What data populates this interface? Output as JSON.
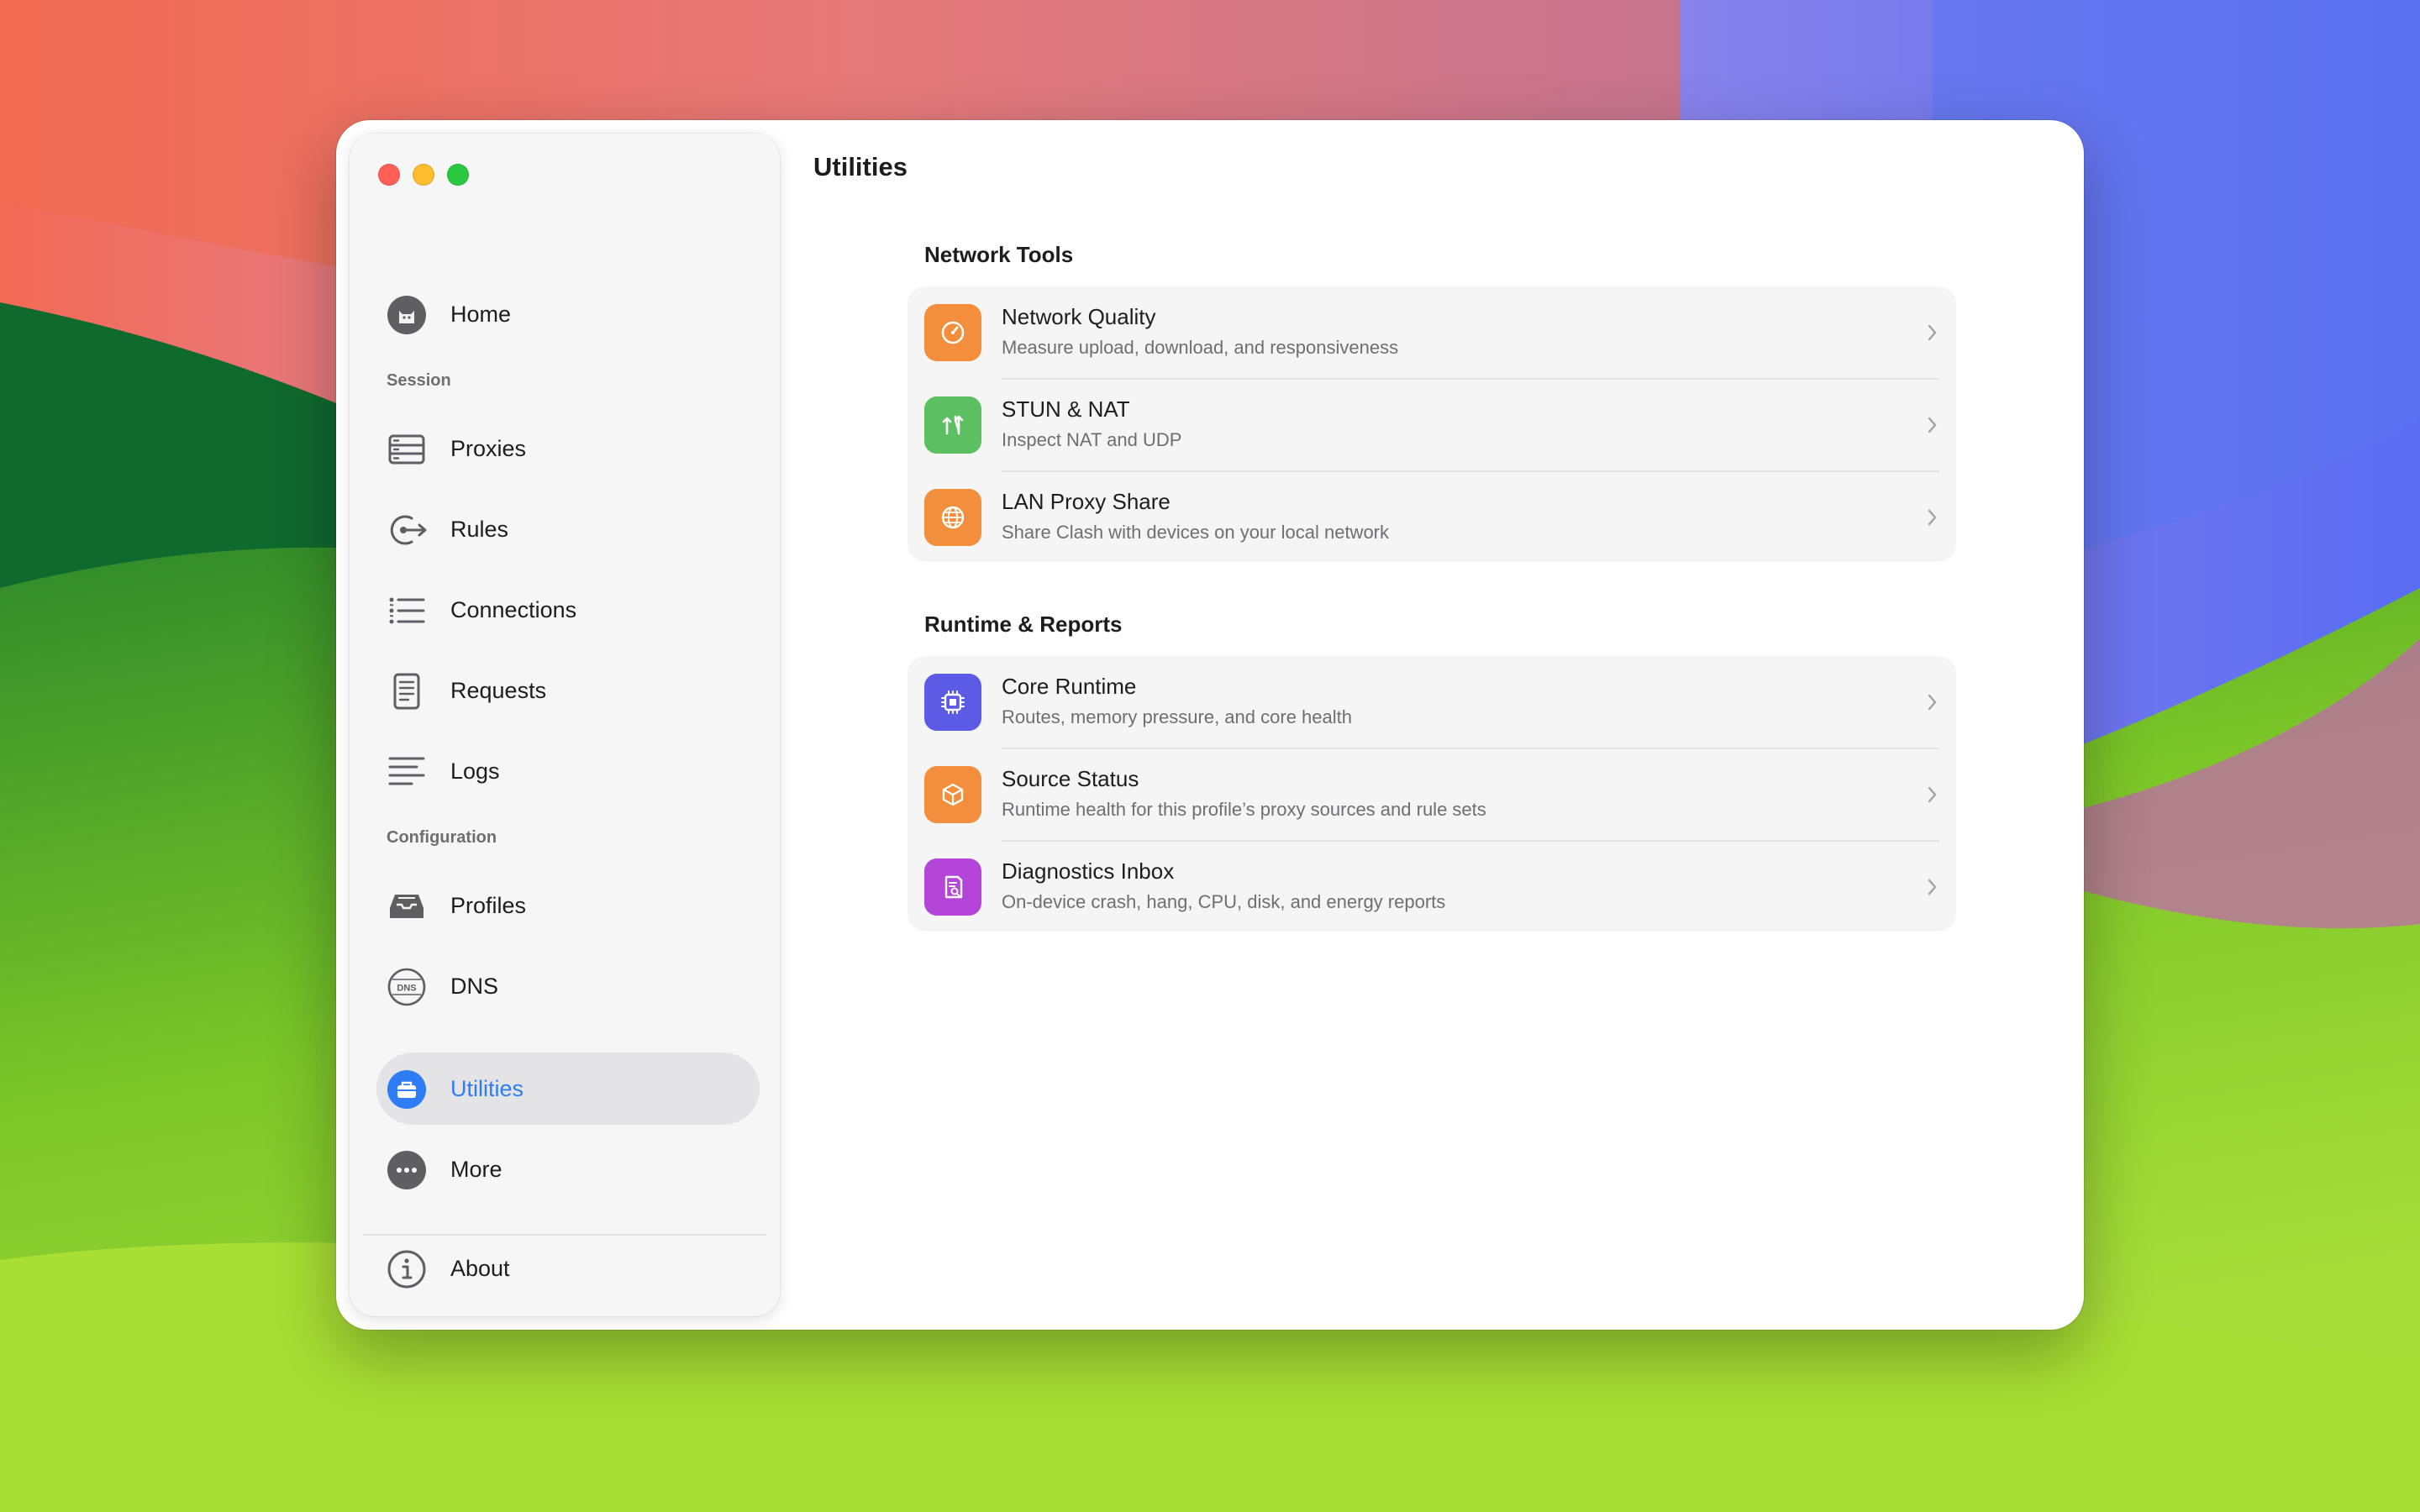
{
  "window": {
    "title": "Utilities"
  },
  "sidebar": {
    "home": {
      "label": "Home",
      "icon": "cat-avatar-icon"
    },
    "sections": {
      "session": "Session",
      "configuration": "Configuration"
    },
    "session_items": [
      {
        "label": "Proxies",
        "icon": "server-rack-icon"
      },
      {
        "label": "Rules",
        "icon": "rules-arrow-icon"
      },
      {
        "label": "Connections",
        "icon": "list-icon"
      },
      {
        "label": "Requests",
        "icon": "document-list-icon"
      },
      {
        "label": "Logs",
        "icon": "text-lines-icon"
      }
    ],
    "configuration_items": [
      {
        "label": "Profiles",
        "icon": "tray-icon"
      },
      {
        "label": "DNS",
        "icon": "dns-globe-icon"
      }
    ],
    "utilities": {
      "label": "Utilities",
      "icon": "toolbox-icon",
      "selected": true
    },
    "more": {
      "label": "More",
      "icon": "ellipsis-circle-icon"
    },
    "about": {
      "label": "About",
      "icon": "info-circle-icon"
    }
  },
  "groups": [
    {
      "title": "Network Tools",
      "items": [
        {
          "title": "Network Quality",
          "subtitle": "Measure upload, download, and responsiveness",
          "icon": "gauge-icon",
          "color": "#f38e3c"
        },
        {
          "title": "STUN & NAT",
          "subtitle": "Inspect NAT and UDP",
          "icon": "arrows-updown-icon",
          "color": "#5cc062"
        },
        {
          "title": "LAN Proxy Share",
          "subtitle": "Share Clash with devices on your local network",
          "icon": "globe-icon",
          "color": "#f38e3c"
        }
      ]
    },
    {
      "title": "Runtime & Reports",
      "items": [
        {
          "title": "Core Runtime",
          "subtitle": "Routes, memory pressure, and core health",
          "icon": "cpu-icon",
          "color": "#5b5be6"
        },
        {
          "title": "Source Status",
          "subtitle": "Runtime health for this profile’s proxy sources and rule sets",
          "icon": "cube-icon",
          "color": "#f38e3c"
        },
        {
          "title": "Diagnostics Inbox",
          "subtitle": "On-device crash, hang, CPU, disk, and energy reports",
          "icon": "report-search-icon",
          "color": "#b544d8"
        }
      ]
    }
  ],
  "colors": {
    "accent": "#2f7df6",
    "selected_bg": "#e4e4e6"
  }
}
